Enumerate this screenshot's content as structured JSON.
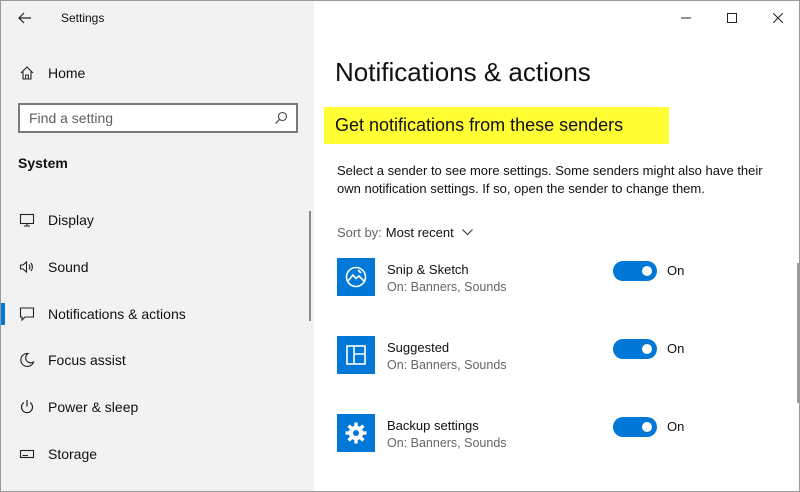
{
  "window": {
    "title": "Settings"
  },
  "sidebar": {
    "home_label": "Home",
    "search_placeholder": "Find a setting",
    "section_title": "System",
    "items": [
      {
        "label": "Display",
        "icon": "display-icon"
      },
      {
        "label": "Sound",
        "icon": "sound-icon"
      },
      {
        "label": "Notifications & actions",
        "icon": "notifications-icon",
        "selected": true
      },
      {
        "label": "Focus assist",
        "icon": "moon-icon"
      },
      {
        "label": "Power & sleep",
        "icon": "power-icon"
      },
      {
        "label": "Storage",
        "icon": "storage-icon"
      }
    ]
  },
  "main": {
    "page_title": "Notifications & actions",
    "section_heading": "Get notifications from these senders",
    "description": "Select a sender to see more settings. Some senders might also have their own notification settings. If so, open the sender to change them.",
    "sort": {
      "label": "Sort by:",
      "value": "Most recent"
    },
    "senders": [
      {
        "name": "Snip & Sketch",
        "status": "On: Banners, Sounds",
        "toggle_label": "On",
        "enabled": true,
        "icon": "snip-sketch-icon"
      },
      {
        "name": "Suggested",
        "status": "On: Banners, Sounds",
        "toggle_label": "On",
        "enabled": true,
        "icon": "suggested-icon"
      },
      {
        "name": "Backup settings",
        "status": "On: Banners, Sounds",
        "toggle_label": "On",
        "enabled": true,
        "icon": "gear-icon"
      }
    ]
  },
  "colors": {
    "accent": "#0078d7",
    "highlight": "#ffff33",
    "sidebar_bg": "#f2f2f2"
  }
}
